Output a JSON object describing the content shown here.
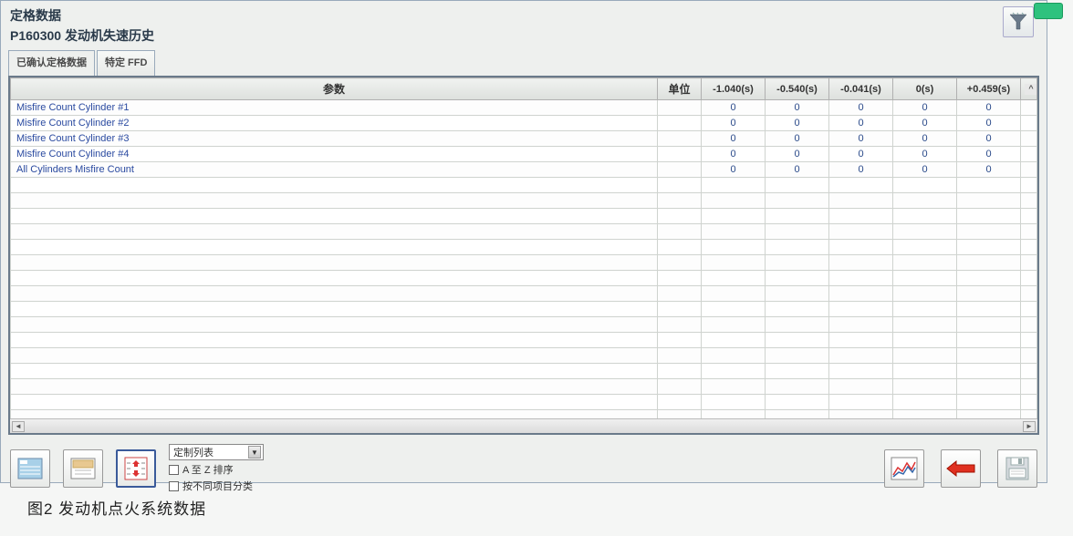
{
  "header": {
    "title_main": "定格数据",
    "title_sub": "P160300  发动机失速历史"
  },
  "tabs": [
    {
      "label": "已确认定格数据",
      "active": true
    },
    {
      "label": "特定 FFD",
      "active": false
    }
  ],
  "table": {
    "columns": {
      "param": "参数",
      "unit": "单位",
      "times": [
        "-1.040(s)",
        "-0.540(s)",
        "-0.041(s)",
        "0(s)",
        "+0.459(s)"
      ]
    },
    "rows": [
      {
        "param": "Misfire Count Cylinder #1",
        "unit": "",
        "values": [
          "0",
          "0",
          "0",
          "0",
          "0"
        ]
      },
      {
        "param": "Misfire Count Cylinder #2",
        "unit": "",
        "values": [
          "0",
          "0",
          "0",
          "0",
          "0"
        ]
      },
      {
        "param": "Misfire Count Cylinder #3",
        "unit": "",
        "values": [
          "0",
          "0",
          "0",
          "0",
          "0"
        ]
      },
      {
        "param": "Misfire Count Cylinder #4",
        "unit": "",
        "values": [
          "0",
          "0",
          "0",
          "0",
          "0"
        ]
      },
      {
        "param": "All Cylinders Misfire Count",
        "unit": "",
        "values": [
          "0",
          "0",
          "0",
          "0",
          "0"
        ]
      }
    ],
    "empty_rows": 16
  },
  "toolbar": {
    "select_label": "定制列表",
    "sort_label": "A 至 Z 排序",
    "group_label": "按不同项目分类"
  },
  "caption": "图2  发动机点火系统数据"
}
